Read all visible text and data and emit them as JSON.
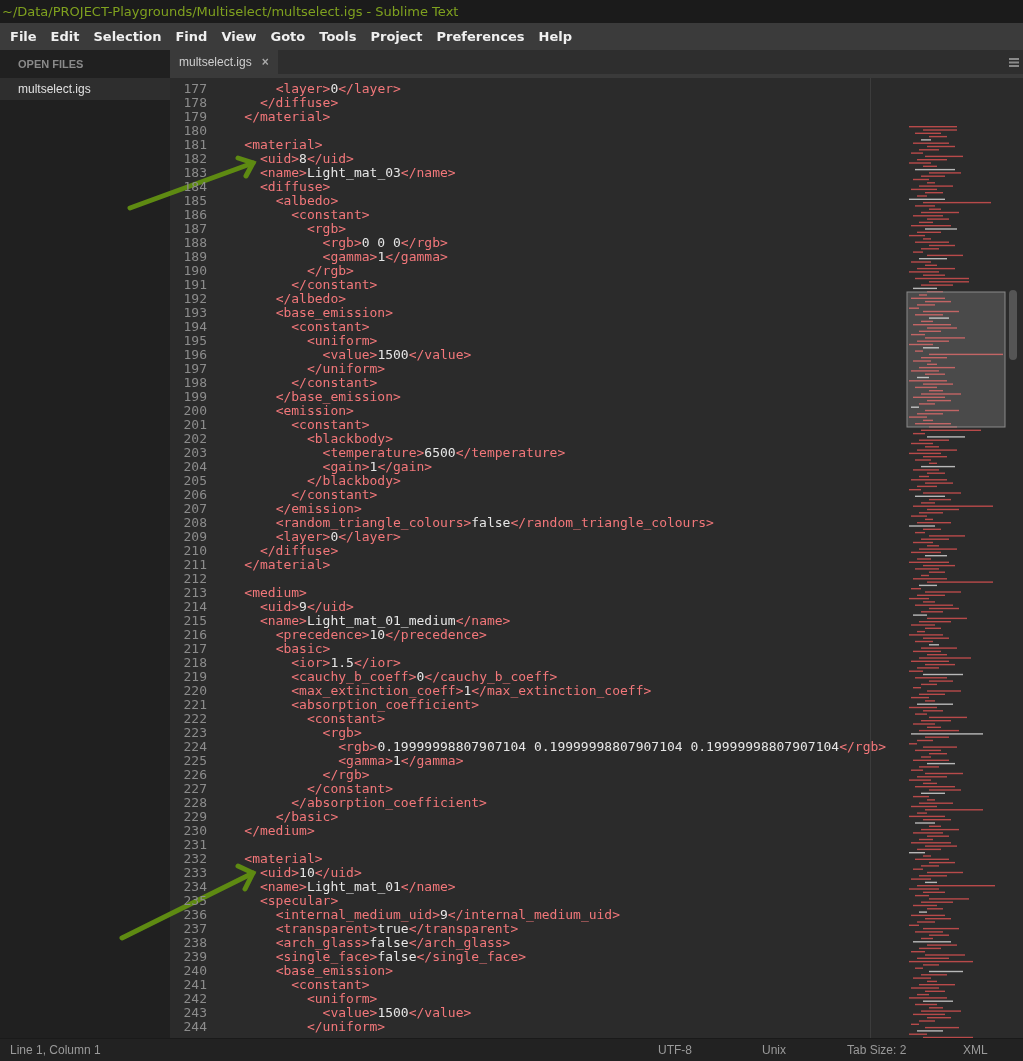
{
  "window": {
    "title": "~/Data/PROJECT-Playgrounds/Multiselect/multselect.igs - Sublime Text"
  },
  "menu": [
    "File",
    "Edit",
    "Selection",
    "Find",
    "View",
    "Goto",
    "Tools",
    "Project",
    "Preferences",
    "Help"
  ],
  "sidebar": {
    "heading": "OPEN FILES",
    "items": [
      {
        "label": "multselect.igs",
        "selected": true
      }
    ]
  },
  "tabs": [
    {
      "label": "multselect.igs",
      "close": "×",
      "selected": true
    }
  ],
  "editor": {
    "lines": [
      {
        "number": "177",
        "text": "        <layer>0</layer>"
      },
      {
        "number": "178",
        "text": "      </diffuse>"
      },
      {
        "number": "179",
        "text": "    </material>"
      },
      {
        "number": "180"
      },
      {
        "number": "181",
        "text": "    <material>"
      },
      {
        "number": "182",
        "text": "      <uid>8</uid>"
      },
      {
        "number": "183",
        "text": "      <name>Light_mat_03</name>"
      },
      {
        "number": "184",
        "text": "      <diffuse>"
      },
      {
        "number": "185",
        "text": "        <albedo>"
      },
      {
        "number": "186",
        "text": "          <constant>"
      },
      {
        "number": "187",
        "text": "            <rgb>"
      },
      {
        "number": "188",
        "text": "              <rgb>0 0 0</rgb>"
      },
      {
        "number": "189",
        "text": "              <gamma>1</gamma>"
      },
      {
        "number": "190",
        "text": "            </rgb>"
      },
      {
        "number": "191",
        "text": "          </constant>"
      },
      {
        "number": "192",
        "text": "        </albedo>"
      },
      {
        "number": "193",
        "text": "        <base_emission>"
      },
      {
        "number": "194",
        "text": "          <constant>"
      },
      {
        "number": "195",
        "text": "            <uniform>"
      },
      {
        "number": "196",
        "text": "              <value>1500</value>"
      },
      {
        "number": "197",
        "text": "            </uniform>"
      },
      {
        "number": "198",
        "text": "          </constant>"
      },
      {
        "number": "199",
        "text": "        </base_emission>"
      },
      {
        "number": "200",
        "text": "        <emission>"
      },
      {
        "number": "201",
        "text": "          <constant>"
      },
      {
        "number": "202",
        "text": "            <blackbody>"
      },
      {
        "number": "203",
        "text": "              <temperature>6500</temperature>"
      },
      {
        "number": "204",
        "text": "              <gain>1</gain>"
      },
      {
        "number": "205",
        "text": "            </blackbody>"
      },
      {
        "number": "206",
        "text": "          </constant>"
      },
      {
        "number": "207",
        "text": "        </emission>"
      },
      {
        "number": "208",
        "text": "        <random_triangle_colours>false</random_triangle_colours>"
      },
      {
        "number": "209",
        "text": "        <layer>0</layer>"
      },
      {
        "number": "210",
        "text": "      </diffuse>"
      },
      {
        "number": "211",
        "text": "    </material>"
      },
      {
        "number": "212"
      },
      {
        "number": "213",
        "text": "    <medium>"
      },
      {
        "number": "214",
        "text": "      <uid>9</uid>"
      },
      {
        "number": "215",
        "text": "      <name>Light_mat_01_medium</name>"
      },
      {
        "number": "216",
        "text": "        <precedence>10</precedence>"
      },
      {
        "number": "217",
        "text": "        <basic>"
      },
      {
        "number": "218",
        "text": "          <ior>1.5</ior>"
      },
      {
        "number": "219",
        "text": "          <cauchy_b_coeff>0</cauchy_b_coeff>"
      },
      {
        "number": "220",
        "text": "          <max_extinction_coeff>1</max_extinction_coeff>"
      },
      {
        "number": "221",
        "text": "          <absorption_coefficient>"
      },
      {
        "number": "222",
        "text": "            <constant>"
      },
      {
        "number": "223",
        "text": "              <rgb>"
      },
      {
        "number": "224",
        "text": "                <rgb>0.19999998807907104 0.19999998807907104 0.19999998807907104</rgb>"
      },
      {
        "number": "225",
        "text": "                <gamma>1</gamma>"
      },
      {
        "number": "226",
        "text": "              </rgb>"
      },
      {
        "number": "227",
        "text": "            </constant>"
      },
      {
        "number": "228",
        "text": "          </absorption_coefficient>"
      },
      {
        "number": "229",
        "text": "        </basic>"
      },
      {
        "number": "230",
        "text": "    </medium>"
      },
      {
        "number": "231"
      },
      {
        "number": "232",
        "text": "    <material>"
      },
      {
        "number": "233",
        "text": "      <uid>10</uid>"
      },
      {
        "number": "234",
        "text": "      <name>Light_mat_01</name>"
      },
      {
        "number": "235",
        "text": "      <specular>"
      },
      {
        "number": "236",
        "text": "        <internal_medium_uid>9</internal_medium_uid>"
      },
      {
        "number": "237",
        "text": "        <transparent>true</transparent>"
      },
      {
        "number": "238",
        "text": "        <arch_glass>false</arch_glass>"
      },
      {
        "number": "239",
        "text": "        <single_face>false</single_face>"
      },
      {
        "number": "240",
        "text": "        <base_emission>"
      },
      {
        "number": "241",
        "text": "          <constant>"
      },
      {
        "number": "242",
        "text": "            <uniform>"
      },
      {
        "number": "243",
        "text": "              <value>1500</value>"
      },
      {
        "number": "244",
        "text": "            </uniform>"
      }
    ]
  },
  "status_bar": {
    "position": "Line 1, Column 1",
    "encoding": "UTF-8",
    "line_endings": "Unix",
    "tab_size": "Tab Size: 2",
    "syntax": "XML"
  }
}
